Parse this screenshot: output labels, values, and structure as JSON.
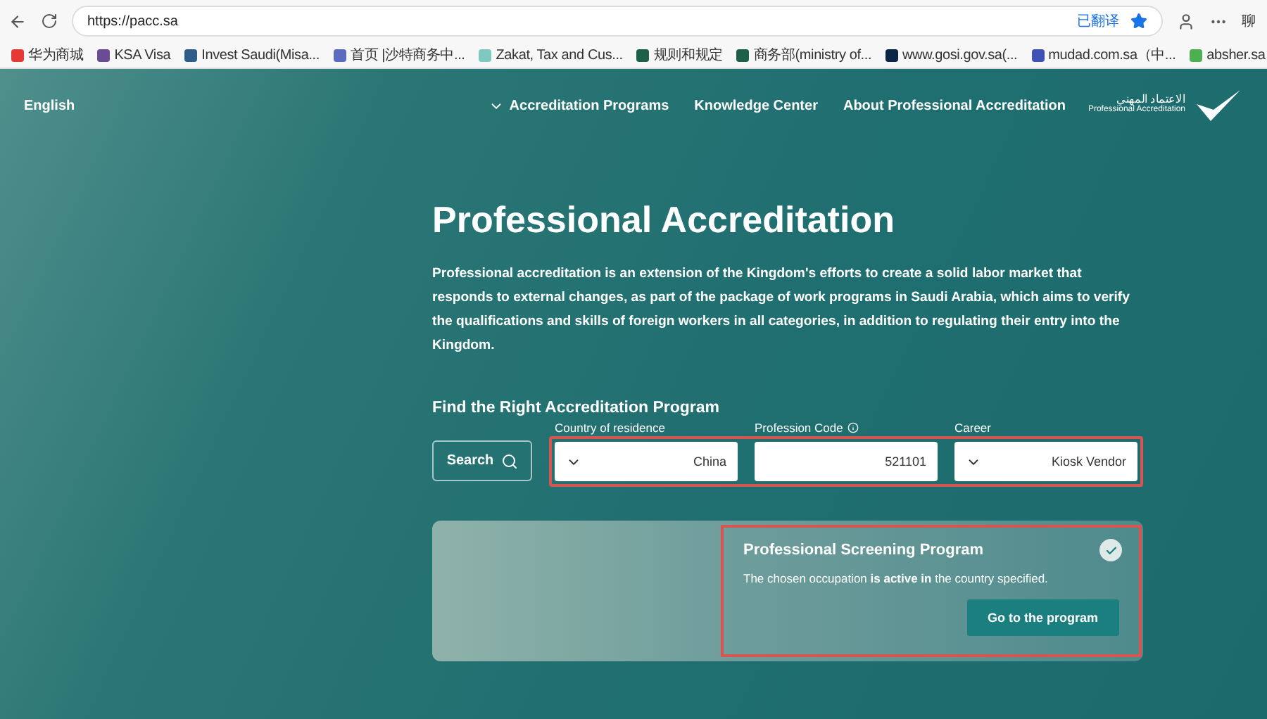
{
  "browser": {
    "url": "https://pacc.sa",
    "translated": "已翻译",
    "edge_text": "聊"
  },
  "bookmarks": [
    {
      "label": "华为商城",
      "color": "#e53935"
    },
    {
      "label": "KSA Visa",
      "color": "#6a4c93"
    },
    {
      "label": "Invest Saudi(Misa...",
      "color": "#2e5d8a"
    },
    {
      "label": "首页 |沙特商务中...",
      "color": "#5c6bc0"
    },
    {
      "label": "Zakat, Tax and Cus...",
      "color": "#7fc8c0"
    },
    {
      "label": "规则和规定",
      "color": "#1e5f4a"
    },
    {
      "label": "商务部(ministry of...",
      "color": "#1e5f4a"
    },
    {
      "label": "www.gosi.gov.sa(...",
      "color": "#0b2545"
    },
    {
      "label": "mudad.com.sa（中...",
      "color": "#3f51b5"
    },
    {
      "label": "absher.sa",
      "color": "#4caf50"
    }
  ],
  "nav": {
    "language": "English",
    "links": [
      {
        "label": "Accreditation Programs",
        "dropdown": true
      },
      {
        "label": "Knowledge Center",
        "dropdown": false
      },
      {
        "label": "About Professional Accreditation",
        "dropdown": false
      }
    ],
    "logo": {
      "arabic": "الاعتماد المهني",
      "english": "Professional Accreditation"
    }
  },
  "hero": {
    "title": "Professional Accreditation",
    "description": "Professional accreditation is an extension of the Kingdom's efforts to create a solid labor market that responds to external changes, as part of the package of work programs in Saudi Arabia, which aims to verify the qualifications and skills of foreign workers in all categories, in addition to regulating their entry into the Kingdom."
  },
  "finder": {
    "heading": "Find the Right Accreditation Program",
    "search_button": "Search",
    "fields": [
      {
        "label": "Country of residence",
        "value": "China",
        "kind": "select",
        "info": false
      },
      {
        "label": "Profession Code",
        "value": "521101",
        "kind": "text",
        "info": true
      },
      {
        "label": "Career",
        "value": "Kiosk Vendor",
        "kind": "select",
        "info": false
      }
    ]
  },
  "result": {
    "title": "Professional Screening Program",
    "message": "The chosen occupation **is active in** the country specified.",
    "button": "Go to the program",
    "checked": true
  }
}
